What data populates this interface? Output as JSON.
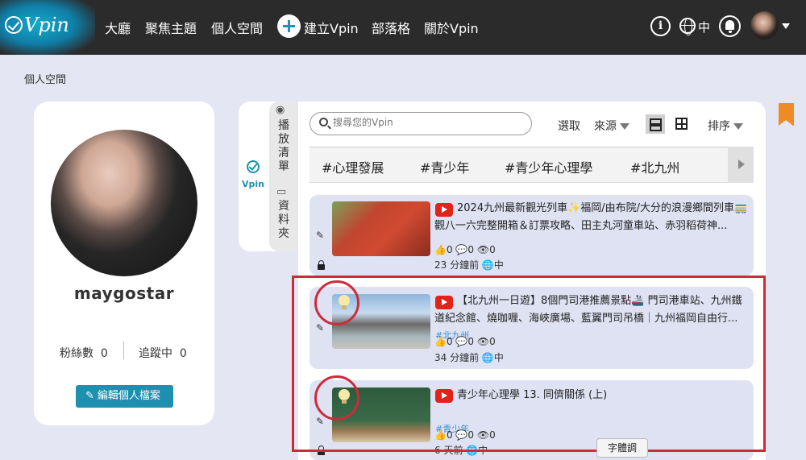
{
  "nav": {
    "logo_text": "Vpin",
    "items": [
      "大廳",
      "聚焦主題",
      "個人空間",
      "建立Vpin",
      "部落格",
      "關於Vpin"
    ],
    "info_glyph": "i",
    "lang": "中"
  },
  "breadcrumb": "個人空間",
  "profile": {
    "username": "maygostar",
    "followers_label": "粉絲數",
    "followers": "0",
    "following_label": "追蹤中",
    "following": "0",
    "edit_button": "編輯個人檔案"
  },
  "side_tabs": {
    "playlist": "播\n放\n清\n單",
    "vpin": "Vpin",
    "folder": "資\n料\n夾"
  },
  "toolbar": {
    "search_placeholder": "搜尋您的Vpin",
    "select": "選取",
    "source": "來源",
    "sort": "排序"
  },
  "tags": [
    "#心理發展",
    "#青少年",
    "#青少年心理學",
    "#北九州"
  ],
  "rows": [
    {
      "title": "2024九州最新觀光列車✨福岡/由布院/大分的浪漫鄉間列車🚃觀八一六完整開箱＆訂票攻略、田主丸河童車站、赤羽稻荷神...",
      "likes": "0",
      "comments": "0",
      "views": "0",
      "time": "23 分鐘前",
      "lang": "中"
    },
    {
      "title": "【北九州一日遊】8個門司港推薦景點🚢 門司港車站、九州鐵道紀念館、燒咖喱、海峽廣場、藍翼門司吊橋｜九州福岡自由行...",
      "tag": "#北九州",
      "likes": "0",
      "comments": "0",
      "views": "0",
      "time": "34 分鐘前",
      "lang": "中"
    },
    {
      "title": "青少年心理學 13. 同儕關係 (上)",
      "tag": "#青少年",
      "likes": "0",
      "comments": "0",
      "views": "0",
      "time": "6 天前",
      "lang": "中"
    }
  ],
  "tooltip": "字體調",
  "colors": {
    "nav_bg": "#2b2b2b",
    "accent": "#1f8fb0",
    "youtube": "#e2231a",
    "annotation": "#cc2b3a",
    "bookmark": "#f08a24"
  }
}
